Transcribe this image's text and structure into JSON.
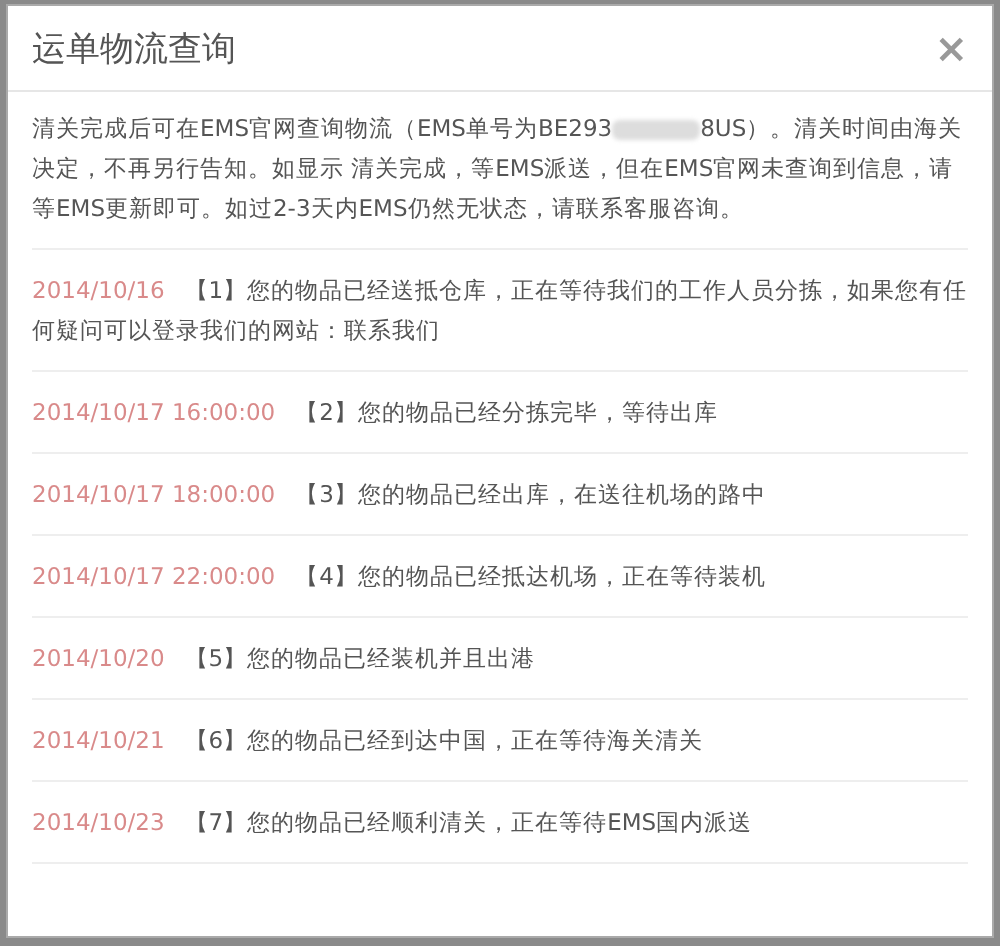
{
  "dialog": {
    "title": "运单物流查询",
    "close": "×"
  },
  "notice": {
    "before": "清关完成后可在EMS官网查询物流（EMS单号为BE293",
    "after": "8US）。清关时间由海关决定，不再另行告知。如显示 清关完成，等EMS派送，但在EMS官网未查询到信息，请等EMS更新即可。如过2-3天内EMS仍然无状态，请联系客服咨询。"
  },
  "events": [
    {
      "time": "2014/10/16",
      "text": "【1】您的物品已经送抵仓库，正在等待我们的工作人员分拣，如果您有任何疑问可以登录我们的网站：联系我们"
    },
    {
      "time": "2014/10/17 16:00:00",
      "text": "【2】您的物品已经分拣完毕，等待出库"
    },
    {
      "time": "2014/10/17 18:00:00",
      "text": "【3】您的物品已经出库，在送往机场的路中"
    },
    {
      "time": "2014/10/17 22:00:00",
      "text": "【4】您的物品已经抵达机场，正在等待装机"
    },
    {
      "time": "2014/10/20",
      "text": "【5】您的物品已经装机并且出港"
    },
    {
      "time": "2014/10/21",
      "text": "【6】您的物品已经到达中国，正在等待海关清关"
    },
    {
      "time": "2014/10/23",
      "text": "【7】您的物品已经顺利清关，正在等待EMS国内派送"
    }
  ]
}
